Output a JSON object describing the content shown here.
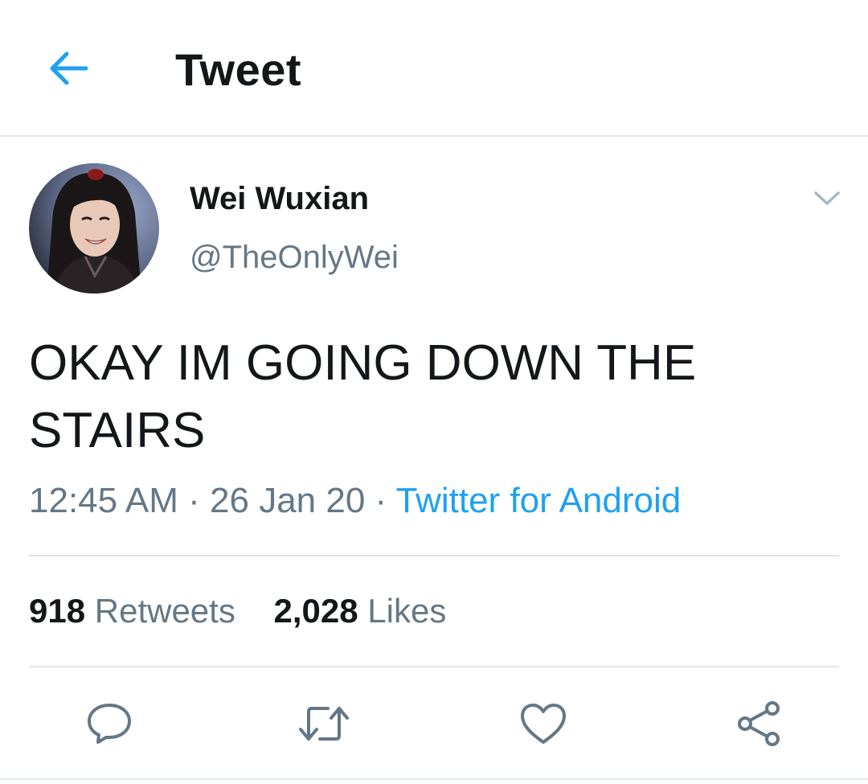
{
  "header": {
    "title": "Tweet",
    "back_icon": "arrow-left-icon"
  },
  "tweet": {
    "author_name": "Wei Wuxian",
    "author_handle": "@TheOnlyWei",
    "text": "OKAY IM GOING DOWN THE STAIRS",
    "time": "12:45 AM",
    "date": "26 Jan 20",
    "separator": "·",
    "source": "Twitter for Android"
  },
  "stats": {
    "retweets_count": "918",
    "retweets_label": "Retweets",
    "likes_count": "2,028",
    "likes_label": "Likes"
  },
  "actions": [
    "reply-icon",
    "retweet-icon",
    "like-icon",
    "share-icon"
  ],
  "colors": {
    "accent": "#1da1f2",
    "text_primary": "#14171a",
    "text_secondary": "#657786",
    "divider": "#dfe6ec"
  }
}
